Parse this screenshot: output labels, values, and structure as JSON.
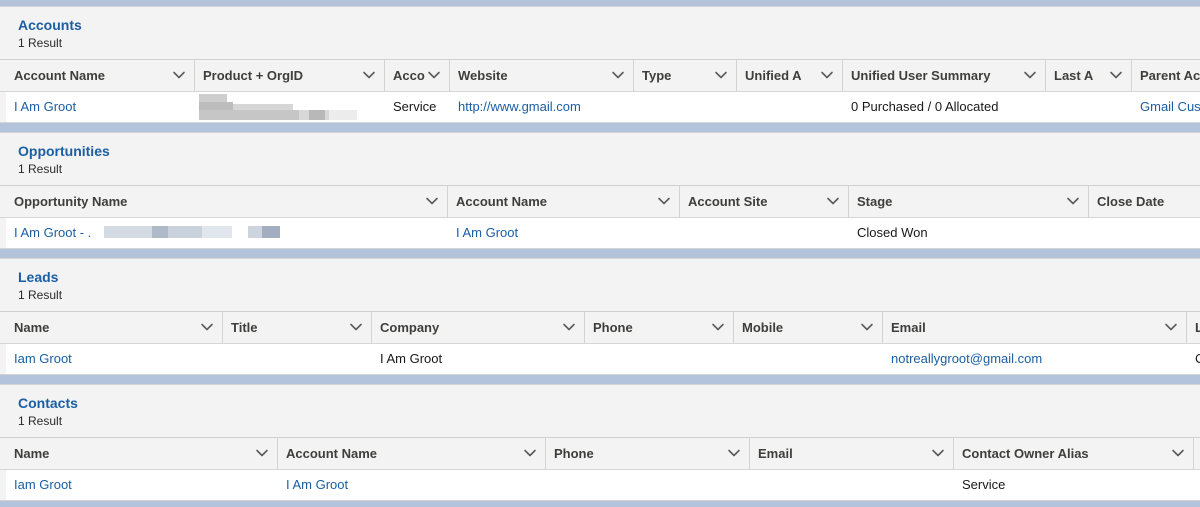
{
  "accounts": {
    "title": "Accounts",
    "count": "1 Result",
    "headers": [
      "Account Name",
      "Product + OrgID",
      "Acco",
      "Website",
      "Type",
      "Unified A",
      "Unified User Summary",
      "Last A",
      "Parent Ac"
    ],
    "row": {
      "account_name": "I Am Groot",
      "product_orgid": "",
      "acco": "Service",
      "website": "http://www.gmail.com",
      "type": "",
      "unified_a": "",
      "unified_user_summary": "0 Purchased / 0 Allocated",
      "last_a": "",
      "parent": "Gmail Cus"
    }
  },
  "opportunities": {
    "title": "Opportunities",
    "count": "1 Result",
    "headers": [
      "Opportunity Name",
      "Account Name",
      "Account Site",
      "Stage",
      "Close Date"
    ],
    "row": {
      "opportunity_name": "I Am Groot - .",
      "account_name": "I Am Groot",
      "account_site": "",
      "stage": "Closed Won",
      "close_date": ""
    }
  },
  "leads": {
    "title": "Leads",
    "count": "1 Result",
    "headers": [
      "Name",
      "Title",
      "Company",
      "Phone",
      "Mobile",
      "Email",
      "L"
    ],
    "row": {
      "name": "Iam Groot",
      "title": "",
      "company": "I Am Groot",
      "phone": "",
      "mobile": "",
      "email": "notreallygroot@gmail.com",
      "l": "C"
    }
  },
  "contacts": {
    "title": "Contacts",
    "count": "1 Result",
    "headers": [
      "Name",
      "Account Name",
      "Phone",
      "Email",
      "Contact Owner Alias"
    ],
    "row": {
      "name": "Iam Groot",
      "account_name": "I Am Groot",
      "phone": "",
      "email": "",
      "owner_alias": "Service"
    }
  },
  "colors": {
    "link": "#1b5ea3",
    "background": "#b4c3dc",
    "header_bg": "#f3f3f3"
  },
  "icons": {
    "column_menu": "chevron-down-icon"
  }
}
